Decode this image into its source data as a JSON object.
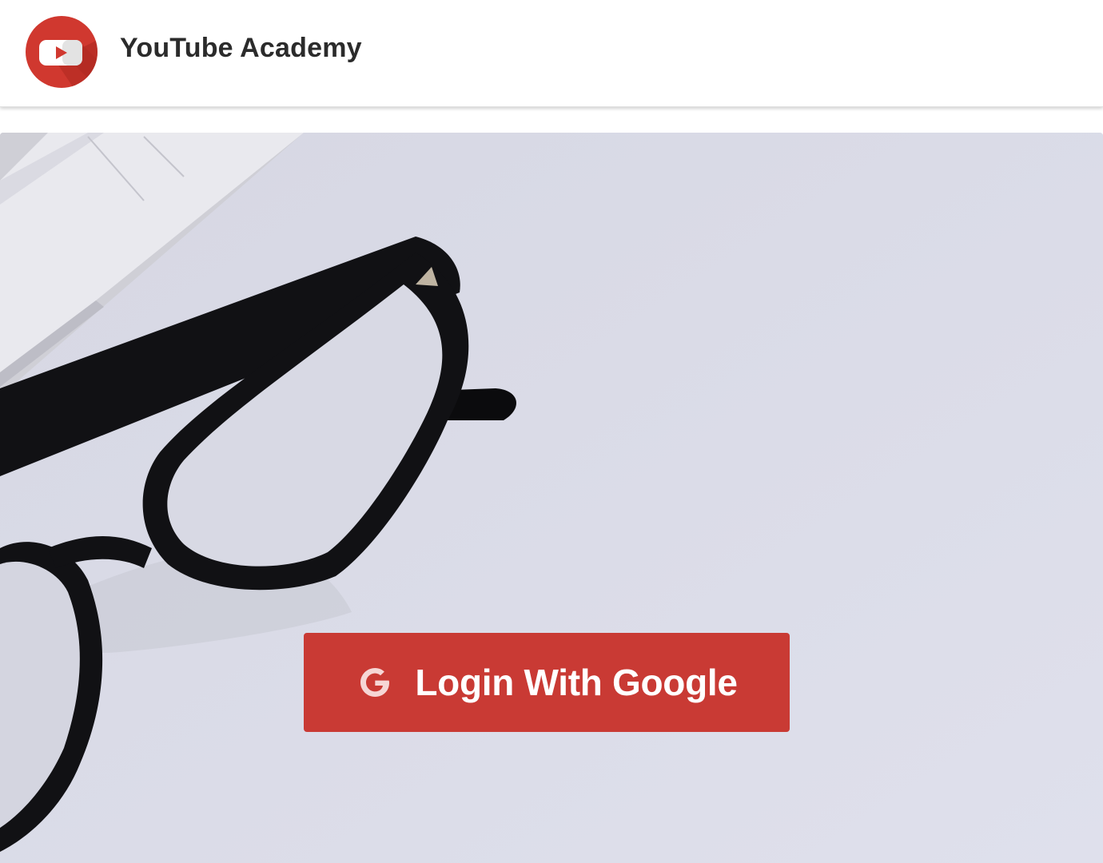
{
  "header": {
    "brand_name": "YouTube Academy",
    "logo_icon": "youtube-play-icon",
    "logo_color": "#d0382f"
  },
  "hero": {
    "background_color": "#dcdde9",
    "login_button": {
      "label": "Login With Google",
      "icon": "google-g-icon",
      "color": "#c93a34"
    }
  }
}
